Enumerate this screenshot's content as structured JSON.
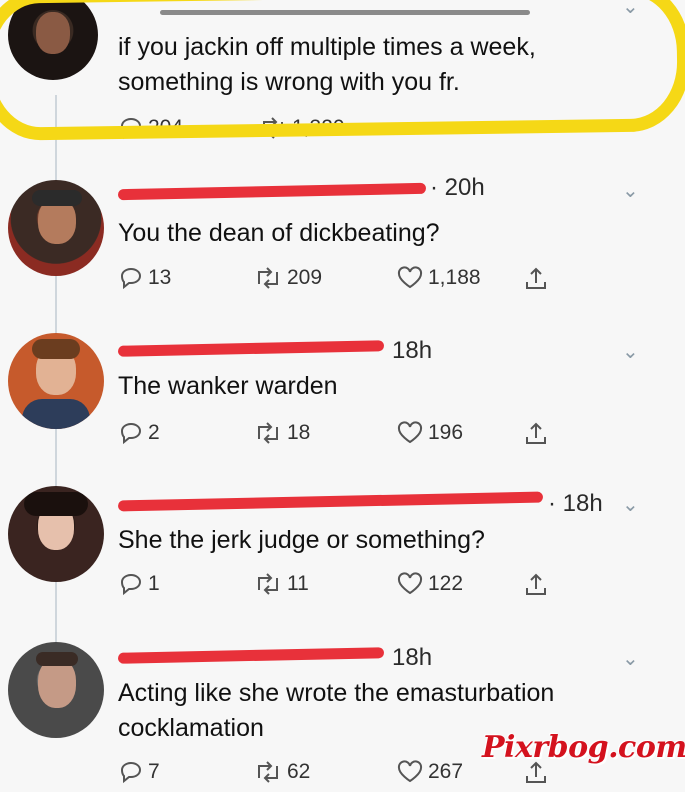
{
  "top_tweet": {
    "text_line1": "if you jackin off multiple times a week,",
    "text_line2": "something is wrong with you fr.",
    "replies": "204",
    "retweets": "1,320"
  },
  "replies": [
    {
      "time": "· 20h",
      "text": "You the dean of dickbeating?",
      "replies": "13",
      "retweets": "209",
      "likes": "1,188"
    },
    {
      "time": "18h",
      "text": "The wanker warden",
      "replies": "2",
      "retweets": "18",
      "likes": "196"
    },
    {
      "time": "· 18h",
      "text": "She the jerk judge or something?",
      "replies": "1",
      "retweets": "11",
      "likes": "122"
    },
    {
      "time": "18h",
      "text_line1": "Acting like she wrote the emasturbation",
      "text_line2": "cocklamation",
      "replies": "7",
      "retweets": "62",
      "likes": "267"
    }
  ],
  "watermark": "Pixrbog.com",
  "colors": {
    "highlight": "#f5d816",
    "redact": "#e8313a",
    "watermark": "#d4121e"
  },
  "icons": [
    "reply-icon",
    "retweet-icon",
    "like-icon",
    "share-icon",
    "chevron-down-icon"
  ]
}
